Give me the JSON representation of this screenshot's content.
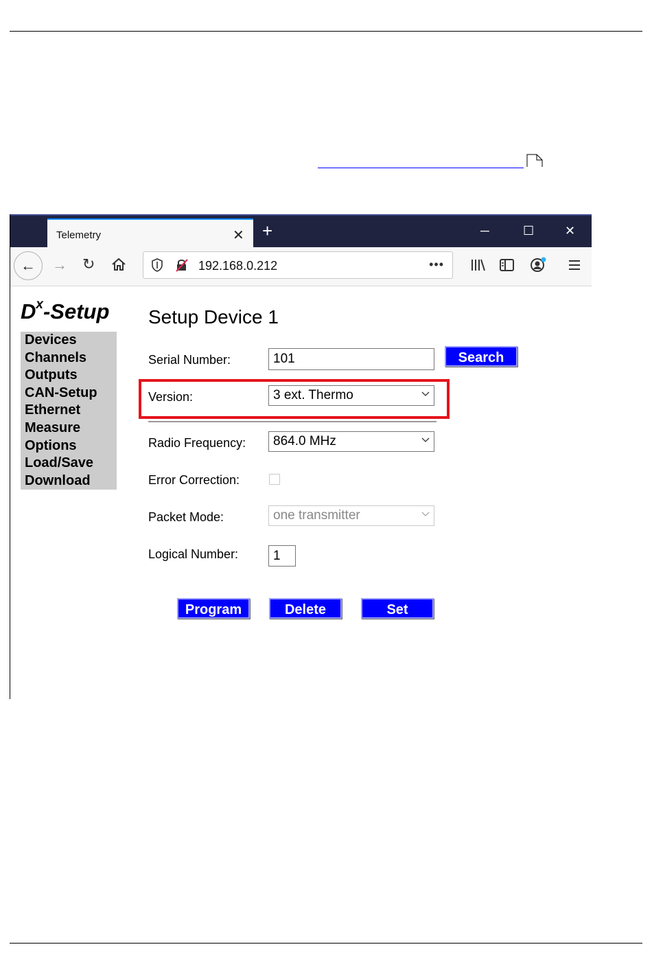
{
  "browser": {
    "tab_title": "Telemetry",
    "tab_close": "✕",
    "new_tab": "+",
    "window": {
      "minimize": "─",
      "maximize": "☐",
      "close": "✕"
    },
    "url": "192.168.0.212",
    "url_more": "•••",
    "accent": "#0a84ff"
  },
  "app": {
    "logo_main": "D",
    "logo_sup": "x",
    "logo_rest": "-Setup",
    "menu": [
      "Devices",
      "Channels",
      "Outputs",
      "CAN-Setup",
      "Ethernet",
      "Measure",
      "Options",
      "Load/Save",
      "Download"
    ]
  },
  "form": {
    "title": "Setup Device 1",
    "serial_label": "Serial Number:",
    "serial_value": "101",
    "search_label": "Search",
    "version_label": "Version:",
    "version_value": "3 ext. Thermo",
    "radio_label": "Radio Frequency:",
    "radio_value": "864.0 MHz",
    "error_label": "Error Correction:",
    "error_checked": false,
    "packet_label": "Packet Mode:",
    "packet_value": "one transmitter",
    "logical_label": "Logical Number:",
    "logical_value": "1",
    "buttons": {
      "program": "Program",
      "delete": "Delete",
      "set": "Set"
    }
  },
  "colors": {
    "button_blue": "#0000ff",
    "highlight_red": "#e5141c",
    "sidebar_gray": "#cccccc",
    "titlebar": "#202340"
  }
}
